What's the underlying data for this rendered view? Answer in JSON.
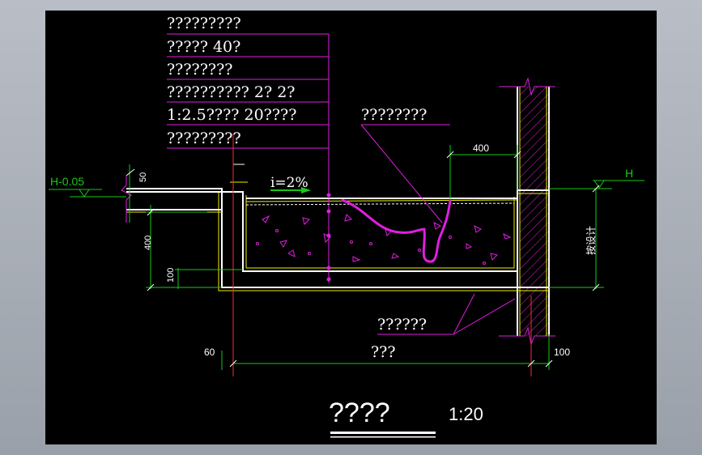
{
  "colors": {
    "background": "#000000",
    "window": "#a7acb4",
    "magenta": "#e01ee0",
    "white": "#ffffff",
    "yellow": "#f0f000",
    "red": "#ff2a2a",
    "green": "#19c819"
  },
  "layer_labels": [
    "?????????",
    "????? 40?",
    "????????",
    "?????????? 2? 2?",
    "1:2.5???? 20????",
    "?????????"
  ],
  "callouts": {
    "drain": "????????",
    "waterproof": "??????"
  },
  "slope": "i=2%",
  "levels": {
    "left": "H-0.05",
    "right": "H"
  },
  "dimensions": {
    "top_width": "400",
    "step": "50",
    "depth": "400",
    "base": "100",
    "left_offset": "60",
    "right_offset": "100",
    "span": "???"
  },
  "side_note": "按设计",
  "drawing_title": "????",
  "scale": "1:20"
}
